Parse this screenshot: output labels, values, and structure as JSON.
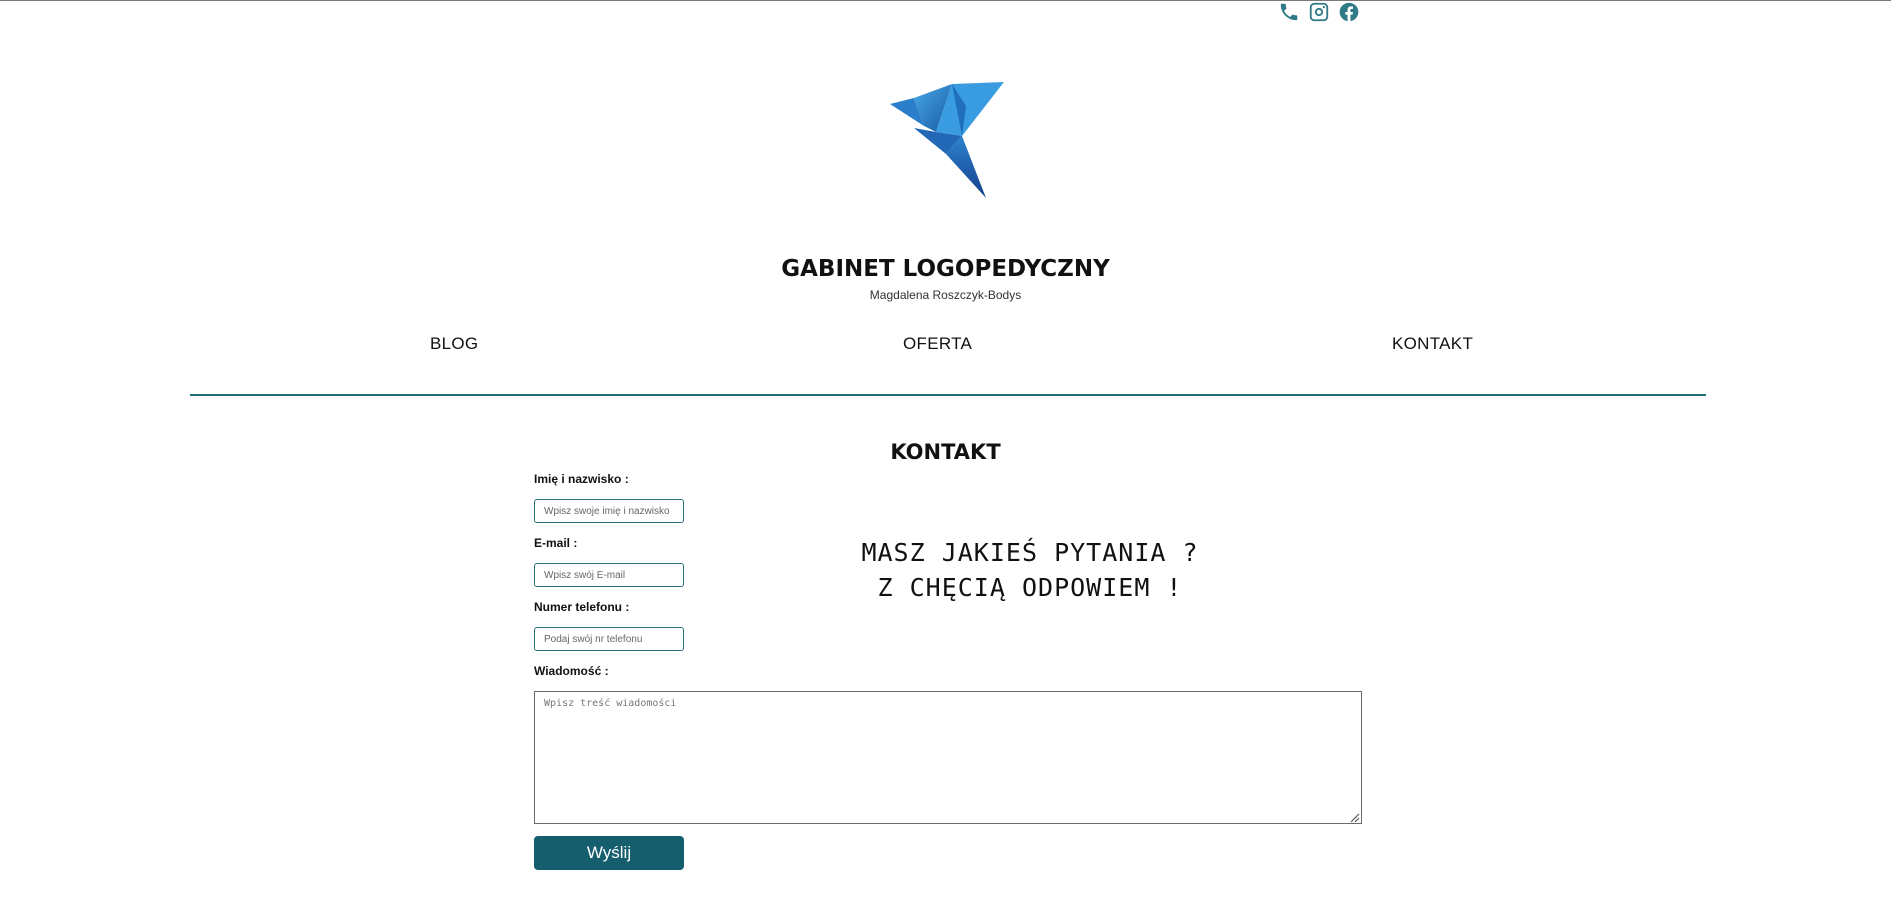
{
  "header": {
    "social": [
      {
        "icon": "phone-icon"
      },
      {
        "icon": "instagram-icon"
      },
      {
        "icon": "facebook-icon"
      }
    ],
    "logo": "origami-bird-logo",
    "title": "GABINET LOGOPEDYCZNY",
    "subtitle": "Magdalena Roszczyk-Bodys"
  },
  "nav": {
    "items": [
      "BLOG",
      "OFERTA",
      "KONTAKT"
    ]
  },
  "contact": {
    "heading": "KONTAKT",
    "name_label": "Imię i nazwisko :",
    "name_placeholder": "Wpisz swoje imię i nazwisko",
    "email_label": "E-mail :",
    "email_placeholder": "Wpisz swój E-mail",
    "phone_label": "Numer telefonu :",
    "phone_placeholder": "Podaj swój nr telefonu",
    "message_label": "Wiadomość :",
    "message_placeholder": "Wpisz treść wiadomości",
    "tagline_line1": "MASZ JAKIEŚ PYTANIA ?",
    "tagline_line2": "Z CHĘCIĄ ODPOWIEM !",
    "submit_label": "Wyślij"
  },
  "colors": {
    "accent": "#1e6c78",
    "button": "#155e6e",
    "icon": "#2e7a86",
    "logo_light": "#3aa0dc",
    "logo_dark": "#1b4f9c"
  }
}
